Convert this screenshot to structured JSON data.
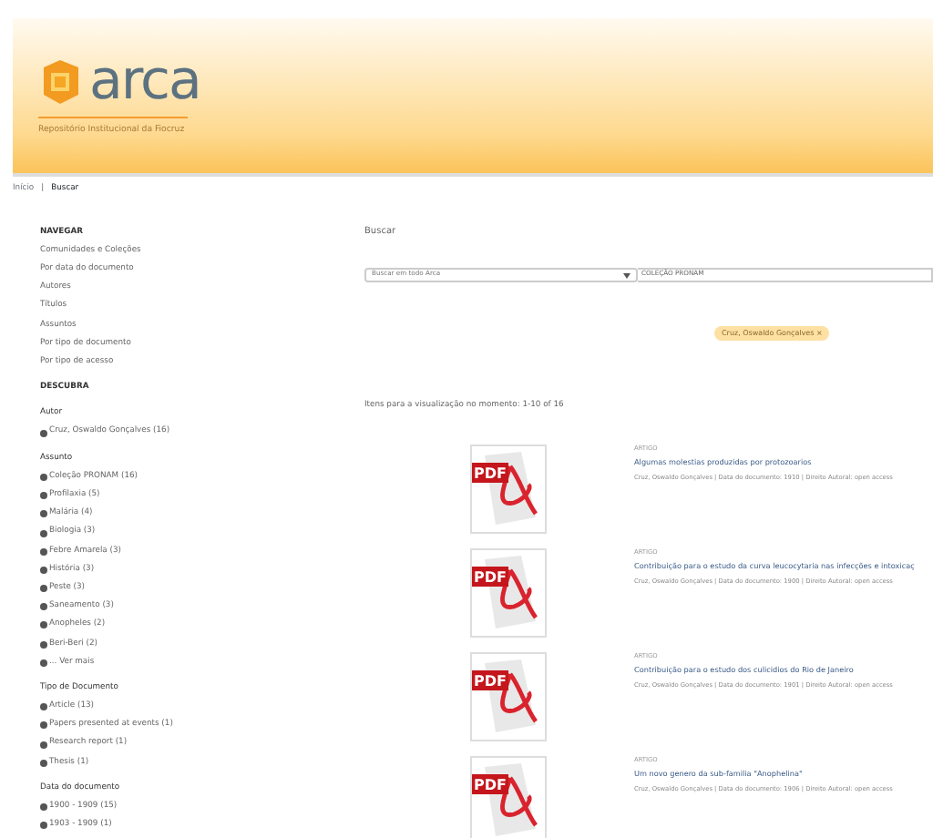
{
  "header": {
    "logo_text": "arca",
    "subtitle": "Repositório Institucional da Fiocruz"
  },
  "breadcrumb": {
    "items": [
      "Início",
      "Buscar"
    ],
    "separator": "|"
  },
  "sidebar": {
    "navigate_heading": "NAVEGAR",
    "navigate_items": [
      "Comunidades e Coleções",
      "Por data do documento",
      "Autores",
      "Títulos",
      "Assuntos",
      "Por tipo de documento",
      "Por tipo de acesso"
    ],
    "discover_heading": "DESCUBRA",
    "facets": [
      {
        "heading": "Autor",
        "items": [
          "Cruz, Oswaldo Gonçalves (16)"
        ]
      },
      {
        "heading": "Assunto",
        "items": [
          "Coleção PRONAM (16)",
          "Profilaxia (5)",
          "Malária (4)",
          "Biologia (3)",
          "Febre Amarela (3)",
          "História (3)",
          "Peste (3)",
          "Saneamento (3)",
          "Anopheles (2)",
          "Beri-Beri (2)",
          "... Ver mais"
        ]
      },
      {
        "heading": "Tipo de Documento",
        "items": [
          "Article (13)",
          "Papers presented at events (1)",
          "Research report (1)",
          "Thesis (1)"
        ]
      },
      {
        "heading": "Data do documento",
        "items": [
          "1900 - 1909 (15)",
          "1903 - 1909 (1)"
        ]
      }
    ]
  },
  "main": {
    "title": "Buscar",
    "scope_select": "Buscar em todo Arca",
    "query": "COLEÇÃO PRONAM",
    "filter_tag": "Cruz, Oswaldo Gonçalves ×",
    "summary": "Itens para a visualização no momento: 1-10 of 16",
    "results": [
      {
        "icon_label": "PDF",
        "type": "ARTIGO",
        "title": "Algumas molestias produzidas por protozoarios",
        "meta": "Cruz, Oswaldo Gonçalves  |  Data do documento: 1910  |  Direito Autoral: open access"
      },
      {
        "icon_label": "PDF",
        "type": "ARTIGO",
        "title": "Contribuição para o estudo da curva leucocytaria nas infecções e intoxicaç",
        "meta": "Cruz, Oswaldo Gonçalves  |  Data do documento: 1900  |  Direito Autoral: open access"
      },
      {
        "icon_label": "PDF",
        "type": "ARTIGO",
        "title": "Contribuição para o estudo dos culicidios do Rio de Janeiro",
        "meta": "Cruz, Oswaldo Gonçalves  |  Data do documento: 1901  |  Direito Autoral: open access"
      },
      {
        "icon_label": "PDF",
        "type": "ARTIGO",
        "title": "Um novo genero da sub-familia \"Anophelina\"",
        "meta": "Cruz, Oswaldo Gonçalves  |  Data do documento: 1906  |  Direito Autoral: open access"
      }
    ]
  }
}
